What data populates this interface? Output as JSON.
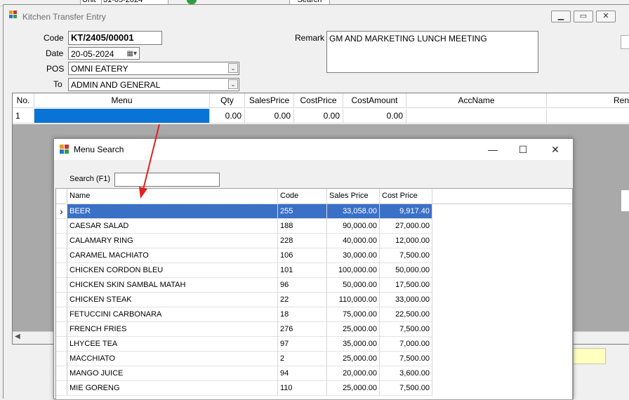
{
  "background_window": {
    "fragment_left": "Unit",
    "fragment_date": "31-05-2024",
    "fragment_button": "Search"
  },
  "kitchen_window": {
    "title": "Kitchen Transfer Entry",
    "code_label": "Code",
    "code_value": "KT/2405/00001",
    "date_label": "Date",
    "date_value": "20-05-2024",
    "pos_label": "POS",
    "pos_value": "OMNI EATERY",
    "to_label": "To",
    "to_value": "ADMIN AND GENERAL",
    "remark_label": "Remark",
    "remark_value": "GM AND MARKETING LUNCH MEETING",
    "grid": {
      "headers": [
        "No.",
        "Menu",
        "Qty",
        "SalesPrice",
        "CostPrice",
        "CostAmount",
        "AccName",
        "Ren"
      ],
      "rows": [
        [
          "1",
          "",
          "0.00",
          "0.00",
          "0.00",
          "0.00",
          "",
          ""
        ]
      ]
    }
  },
  "menu_search": {
    "title": "Menu Search",
    "search_label": "Search (F1)",
    "search_value": "",
    "columns": [
      "Name",
      "Code",
      "Sales Price",
      "Cost Price"
    ],
    "rows": [
      [
        "BEER",
        "255",
        "33,058.00",
        "9,917.40"
      ],
      [
        "CAESAR SALAD",
        "188",
        "90,000.00",
        "27,000.00"
      ],
      [
        "CALAMARY RING",
        "228",
        "40,000.00",
        "12,000.00"
      ],
      [
        "CARAMEL MACHIATO",
        "106",
        "30,000.00",
        "7,500.00"
      ],
      [
        "CHICKEN CORDON BLEU",
        "101",
        "100,000.00",
        "50,000.00"
      ],
      [
        "CHICKEN SKIN SAMBAL MATAH",
        "96",
        "50,000.00",
        "17,500.00"
      ],
      [
        "CHICKEN STEAK",
        "22",
        "110,000.00",
        "33,000.00"
      ],
      [
        "FETUCCINI CARBONARA",
        "18",
        "75,000.00",
        "22,500.00"
      ],
      [
        "FRENCH FRIES",
        "276",
        "25,000.00",
        "7,500.00"
      ],
      [
        "LHYCEE TEA",
        "97",
        "35,000.00",
        "7,000.00"
      ],
      [
        "MACCHIATO",
        "2",
        "25,000.00",
        "7,500.00"
      ],
      [
        "MANGO JUICE",
        "94",
        "20,000.00",
        "3,600.00"
      ],
      [
        "MIE GORENG",
        "110",
        "25,000.00",
        "7,500.00"
      ]
    ]
  },
  "colors": {
    "selection": "#3b70c7",
    "annotation_arrow": "#e02020",
    "highlight_yellow": "#ffffc0"
  }
}
